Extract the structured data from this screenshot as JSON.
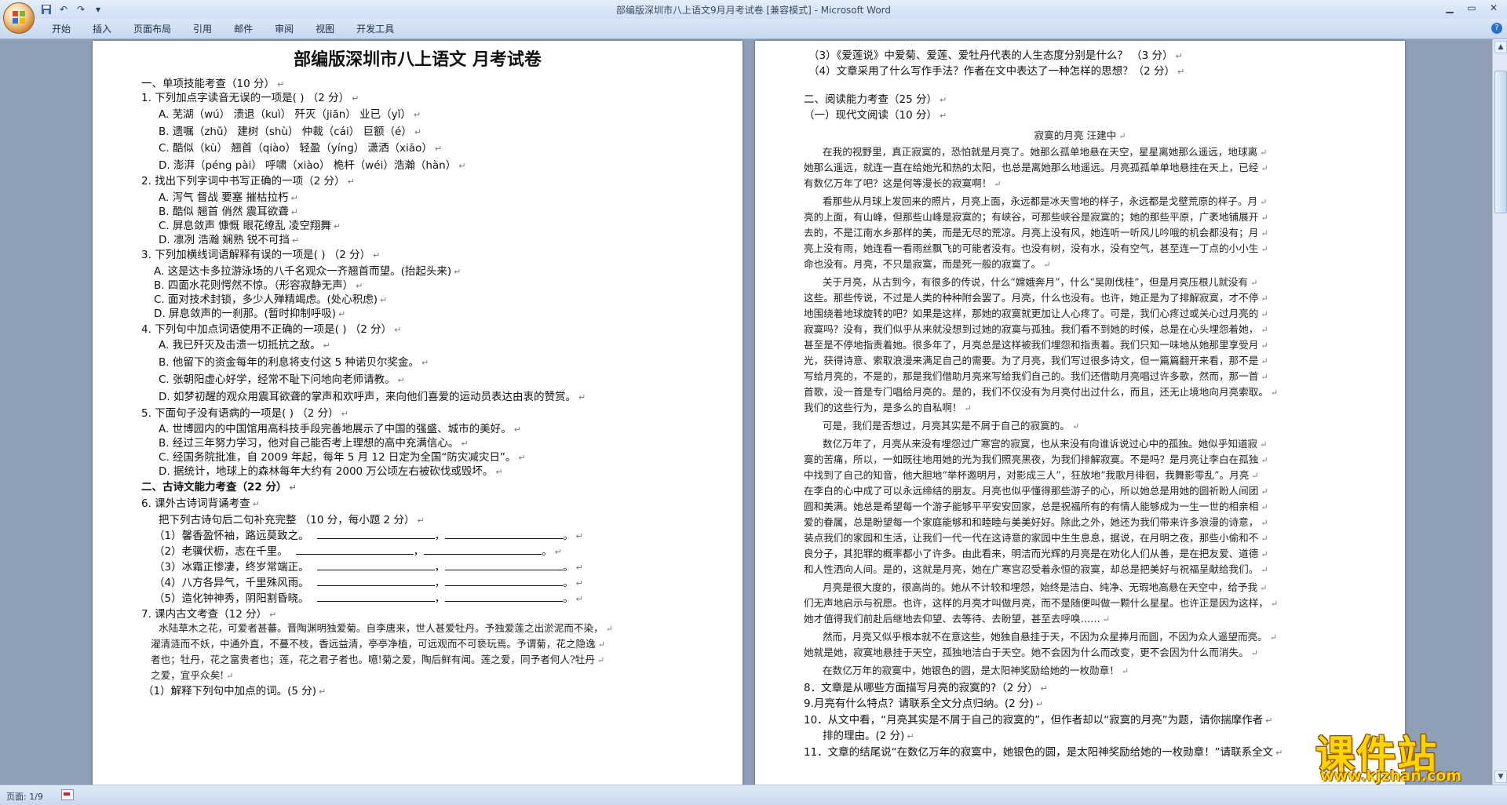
{
  "window": {
    "title": "部编版深圳市八上语文9月月考试卷 [兼容模式] - Microsoft Word"
  },
  "quick_access": {
    "icons": [
      "save-icon",
      "undo-icon",
      "redo-icon",
      "customize-icon"
    ]
  },
  "ribbon": {
    "tabs": [
      "开始",
      "插入",
      "页面布局",
      "引用",
      "邮件",
      "审阅",
      "视图",
      "开发工具"
    ]
  },
  "left_page": {
    "title": "部编版深圳市八上语文  月考试卷",
    "lines": [
      "一、单项技能考查（10 分）",
      "1. 下列加点字读音无误的一项是(     ) （2 分）",
      "A. 芜湖（wú）  溃退（kuì）      歼灭（jiān）   业已（yǐ）",
      "B. 遗嘱（zhǔ）  建树（shù）    仲裁（cái）     巨额（é）",
      "C. 酷似（kù）   翘首（qiào）   轻盈（yíng）   潇洒（xiāo）",
      "D. 澎湃（péng pài）       呼啸（xiào）        桅杆（wéi）浩瀚（hàn）",
      "2. 找出下列字词中书写正确的一项（2 分）",
      "A. 泻气    督战          要塞        摧枯拉朽",
      "B. 酷似    翘首          俏然        震耳欲聋",
      "C. 屏息敛声   慷慨     眼花缭乱   凌空翔舞",
      "D. 凛冽    浩瀚          娴熟        锐不可挡",
      "3. 下列加横线词语解释有误的一项是(     ) （2 分）",
      "A. 这是达卡多拉游泳场的八千名观众一齐翘首而望。(抬起头来)",
      "B. 四面水花则愕然不惊。（形容寂静无声）",
      "C. 面对技术封锁，多少人殚精竭虑。(处心积虑)",
      "D. 屏息敛声的一刹那。(暂时抑制呼吸)",
      "4. 下列句中加点词语使用不正确的一项是(     ) （2 分）",
      "A. 我已歼灭及击溃一切抵抗之敌。",
      "B. 他留下的资金每年的利息将支付这 5 种诺贝尔奖金。",
      "C. 张朝阳虚心好学，经常不耻下问地向老师请教。",
      "D. 如梦初醒的观众用震耳欲聋的掌声和欢呼声，来向他们喜爱的运动员表达由衷的赞赏。",
      "5. 下面句子没有语病的一项是(     ) （2 分）",
      "A. 世博园内的中国馆用高科技手段完善地展示了中国的强盛、城市的美好。",
      "B. 经过三年努力学习，他对自己能否考上理想的高中充满信心。",
      "C. 经国务院批准，自 2009 年起，每年 5 月 12 日定为全国“防灾减灾日”。",
      "D. 据统计，地球上的森林每年大约有 2000 万公顷左右被砍伐或毁坏。",
      "二、古诗文能力考查（22 分）",
      "6. 课外古诗词背诵考查",
      "把下列古诗句后二句补充完整  （10 分，每小题 2 分）",
      "（1）馨香盈怀袖，路远莫致之。",
      "（2）老骥伏枥，志在千里。",
      "（3）冰霜正惨凄，终岁常端正。",
      "（4）八方各异气，千里殊风雨。",
      "（5）造化钟神秀，阴阳割昏晓。",
      "7. 课内古文考查（12 分）",
      "水陆草木之花，可爱者甚蕃。晋陶渊明独爱菊。自李唐来，世人甚爱牡丹。予独爱莲之出淤泥而不染，",
      "濯清涟而不妖，中通外直，不蔓不枝，香远益清，亭亭净植，可远观而不可亵玩焉。予谓菊，花之隐逸",
      "者也；牡丹，花之富贵者也；莲，花之君子者也。噫!菊之爱，陶后鲜有闻。莲之爱，同予者何人?牡丹",
      "之爱，宜乎众矣!",
      "（1）解释下列句中加点的词。(5 分)"
    ]
  },
  "right_page": {
    "lines": [
      "（3）《爱莲说》中爱菊、爱莲、爱牡丹代表的人生态度分别是什么？  （3 分）",
      "（4）文章采用了什么写作手法？作者在文中表达了一种怎样的思想？（2 分）",
      "二、阅读能力考查（25 分）",
      "（一）现代文阅读（10 分）",
      "寂寞的月亮   汪建中",
      "在我的视野里，真正寂寞的，恐怕就是月亮了。她那么孤单地悬在天空，星星离她那么遥远，地球离",
      "她那么遥远，就连一直在给她光和热的太阳，也总是离她那么地遥远。月亮孤孤单单地悬挂在天上，已经",
      "有数亿万年了吧？这是何等漫长的寂寞啊！",
      "看那些从月球上发回来的照片，月亮上面，永远都是冰天雪地的样子，永远都是戈壁荒原的样子。月",
      "亮的上面，有山峰，但那些山峰是寂寞的；有峡谷，可那些峡谷是寂寞的；她的那些平原，广袤地铺展开",
      "去的，不是江南水乡那样的美，而是无尽的荒凉。月亮上没有风，她连听一听风儿吟哦的机会都没有；月",
      "亮上没有雨，她连看一看雨丝飘飞的可能者没有。也没有树，没有水，没有空气，甚至连一丁点的小小生",
      "命也没有。月亮，不只是寂寞，而是死一般的寂寞了。",
      "关于月亮，从古到今，有很多的传说，什么“嫦娥奔月”，什么“吴刚伐桂”，但是月亮压根儿就没有",
      "这些。那些传说，不过是人类的种种附会罢了。月亮，什么也没有。也许，她正是为了排解寂寞，才不停",
      "地围绕着地球旋转的吧？如果是这样，那她的寂寞就更加让人心疼了。可是，我们心疼过或关心过月亮的",
      "寂寞吗？没有，我们似乎从来就没想到过她的寂寞与孤独。我们看不到她的时候，总是在心头埋怨着她，",
      "甚至是不停地指责着她。很多年了，月亮总是这样被我们埋怨和指责着。我们只知一味地从她那里享受月",
      "光，获得诗意、索取浪漫来满足自己的需要。为了月亮，我们写过很多诗文，但一篇篇翻开来看，那不是",
      "写给月亮的，不是的，那是我们借助月亮来写给我们自己的。我们还借助月亮唱过许多歌，然而，那一首",
      "首歌，没一首是专门唱给月亮的。是的，我们不仅没有为月亮付出过什么，而且，还无止境地向月亮索取。",
      "我们的这些行为，是多么的自私啊！",
      "可是，我们是否想过，月亮其实是不屑于自己的寂寞的。",
      "数亿万年了，月亮从来没有埋怨过广寒宫的寂寞，也从来没有向谁诉说过心中的孤独。她似乎知道寂",
      "寞的苦痛，所以，一如既往地用她的光为我们照亮黑夜，为我们排解寂寞。不是吗？是月亮让李白在孤独",
      "中找到了自己的知音，他大胆地“举杯邀明月，对影成三人”，狂放地“我歌月徘徊，我舞影零乱”。月亮",
      "在李白的心中成了可以永远缔结的朋友。月亮也似乎懂得那些游子的心，所以她总是用她的圆祈盼人间团",
      "圆和美满。她总是希望每一个游子能够平平安安回家，总是祝福所有的有情人能够成为一生一世的相亲相",
      "爱的眷属，总是盼望每一个家庭能够和和睦睦与美美好好。除此之外，她还为我们带来许多浪漫的诗意，",
      "装点我们的家园和生活，让我们一代一代在这诗意的家园中生生息息，据说，在月明之夜，那些小偷和不",
      "良分子，其犯罪的概率都小了许多。由此看来，明洁而光辉的月亮是在劝化人们从善，是在把友爱、道德",
      "和人性洒向人间。是的，这就是月亮，她在广寒宫忍受着永恒的寂寞，却总是把美好与祝福呈献给我们。",
      "月亮是很大度的，很高尚的。她从不计较和埋怨，始终是洁白、纯净、无瑕地高悬在天空中，给予我",
      "们无声地启示与祝愿。也许，这样的月亮才叫做月亮，而不是随便叫做一颗什么星星。也许正是因为这样，",
      "她才值得我们前赴后继地去仰望、去等待、去盼望，甚至去呼唤……",
      "然而，月亮又似乎根本就不在意这些，她独自悬挂于天，不因为众星捧月而圆，不因为众人遥望而亮。",
      "她就是她，寂寞地悬挂于天空，孤独地洁白于天空。她不会因为什么而改变，更不会因为什么而消失。",
      "在数亿万年的寂寞中，她银色的圆，是太阳神奖励给她的一枚勋章！",
      "8．文章是从哪些方面描写月亮的寂寞的?（2 分）",
      "9.月亮有什么特点？请联系全文分点归纳。(2 分)",
      "10．从文中看，“月亮其实是不屑于自己的寂寞的”，但作者却以“寂寞的月亮”为题，请你揣摩作者",
      "排的理由。(2 分)",
      "11．文章的结尾说“在数亿万年的寂寞中，她银色的圆，是太阳神奖励给她的一枚勋章！”请联系全文"
    ]
  },
  "status_bar": {
    "page_info": "页面: 1/9"
  },
  "watermark": {
    "brand": "课件站",
    "url": "www.kjzhan.com"
  },
  "colors": {
    "workspace": "#8f9fb6",
    "ribbon": "#c6d8ef",
    "watermark": "#ffd400"
  }
}
